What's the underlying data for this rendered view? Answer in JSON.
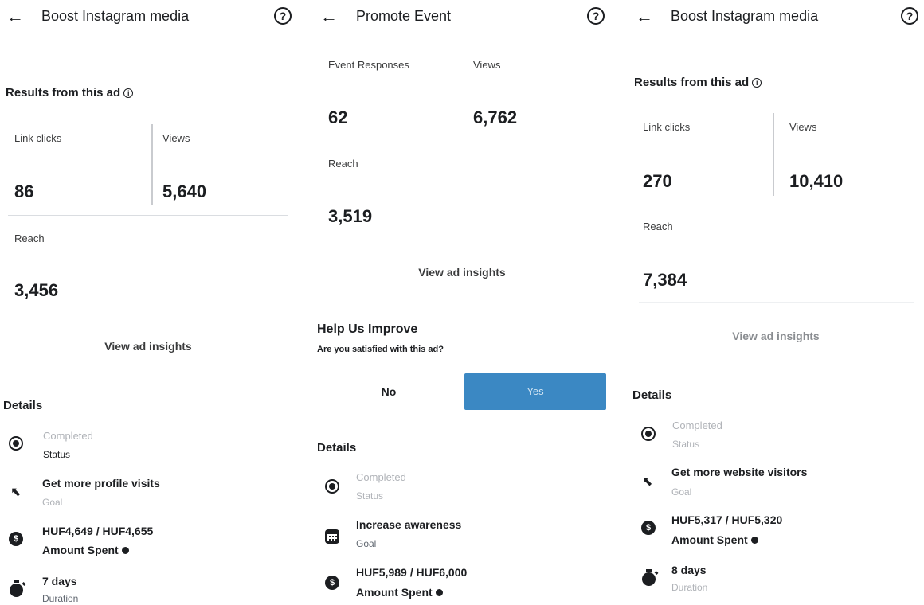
{
  "panels": [
    {
      "title": "Boost Instagram media",
      "results_heading": "Results from this ad",
      "metrics": {
        "link_clicks_label": "Link clicks",
        "link_clicks_value": "86",
        "views_label": "Views",
        "views_value": "5,640",
        "reach_label": "Reach",
        "reach_value": "3,456"
      },
      "insights_link": "View ad insights",
      "details_heading": "Details",
      "details": [
        {
          "icon": "status-dot-icon",
          "main": "Completed",
          "sub": "Status"
        },
        {
          "icon": "cursor-icon",
          "main": "Get more profile visits",
          "sub": "Goal"
        },
        {
          "icon": "dollar-icon",
          "main": "HUF4,649 / HUF4,655",
          "sub": "Amount Spent"
        },
        {
          "icon": "timer-icon",
          "main": "7 days",
          "sub": "Duration"
        }
      ]
    },
    {
      "title": "Promote Event",
      "metrics": {
        "event_responses_label": "Event Responses",
        "event_responses_value": "62",
        "views_label": "Views",
        "views_value": "6,762",
        "reach_label": "Reach",
        "reach_value": "3,519"
      },
      "insights_link": "View ad insights",
      "survey": {
        "title": "Help Us Improve",
        "question": "Are you satisfied with this ad?",
        "no_label": "No",
        "yes_label": "Yes"
      },
      "details_heading": "Details",
      "details": [
        {
          "icon": "status-dot-icon",
          "main": "Completed",
          "sub": "Status"
        },
        {
          "icon": "calendar-icon",
          "main": "Increase awareness",
          "sub": "Goal"
        },
        {
          "icon": "dollar-icon",
          "main": "HUF5,989 / HUF6,000",
          "sub": "Amount Spent"
        }
      ]
    },
    {
      "title": "Boost Instagram media",
      "results_heading": "Results from this ad",
      "metrics": {
        "link_clicks_label": "Link clicks",
        "link_clicks_value": "270",
        "views_label": "Views",
        "views_value": "10,410",
        "reach_label": "Reach",
        "reach_value": "7,384"
      },
      "insights_link": "View ad insights",
      "details_heading": "Details",
      "details": [
        {
          "icon": "status-dot-icon",
          "main": "Completed",
          "sub": "Status"
        },
        {
          "icon": "cursor-icon",
          "main": "Get more website visitors",
          "sub": "Goal"
        },
        {
          "icon": "dollar-icon",
          "main": "HUF5,317 / HUF5,320",
          "sub": "Amount Spent"
        },
        {
          "icon": "timer-icon",
          "main": "8 days",
          "sub": "Duration"
        }
      ]
    }
  ]
}
